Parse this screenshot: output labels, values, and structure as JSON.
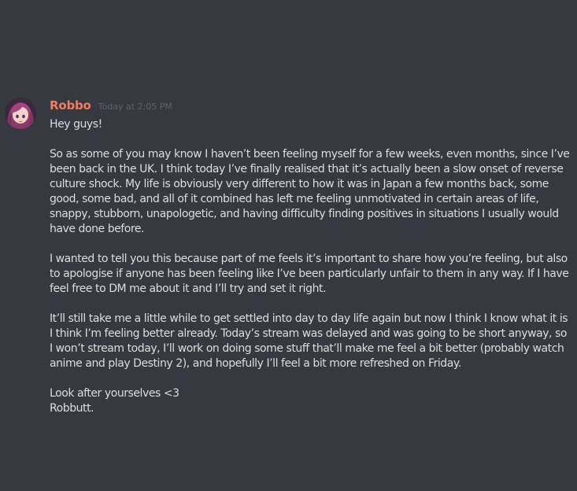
{
  "message": {
    "author": "Robbo",
    "timestamp": "Today at 2:05 PM",
    "author_color": "#f47b5e",
    "avatar": "anime-girl-avatar-icon",
    "paragraphs": [
      "Hey guys!",
      "So as some of you may know I haven’t been feeling myself for a few weeks, even months, since I’ve been back in the UK. I think today I’ve finally realised that it’s actually been a slow onset of reverse culture shock. My life is obviously very different to how it was in Japan a few months back, some good, some bad, and all of it combined has left me feeling unmotivated in certain areas of life, snappy, stubborn, unapologetic, and having difficulty finding positives in situations I usually would have done before.",
      "I wanted to tell you this because part of me feels it’s important to share how you’re feeling, but also to apologise if anyone has been feeling like I’ve been particularly unfair to them in any way. If I have feel free to DM me about it and I’ll try and set it right.",
      "It’ll still take me a little while to get settled into day to day life again but now I think I know what it is I think I’m feeling better already. Today’s stream was delayed and was going to be short anyway, so I won’t stream today, I’ll work on doing some stuff that’ll make me feel a bit better (probably watch anime and play Destiny 2), and hopefully I’ll feel a bit more refreshed on Friday.",
      "Look after yourselves <3",
      "Robbutt."
    ]
  },
  "colors": {
    "background": "#36393f",
    "text": "#dcddde",
    "timestamp": "#5e6167"
  }
}
